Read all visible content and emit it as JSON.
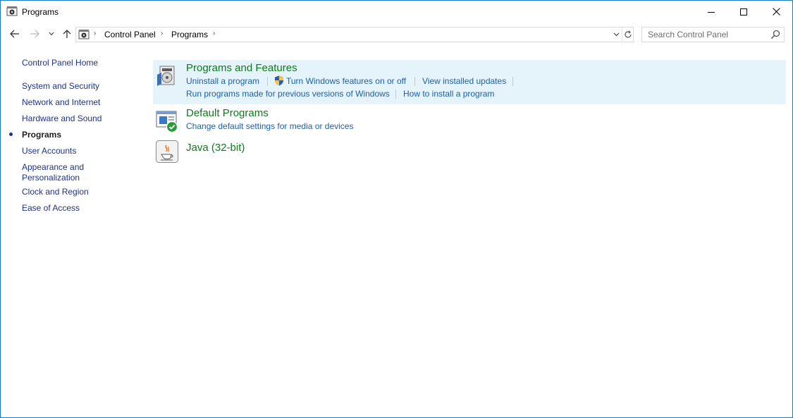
{
  "window": {
    "title": "Programs",
    "controls": {
      "minimize": "minimize",
      "maximize": "maximize",
      "close": "close"
    }
  },
  "address": {
    "breadcrumbs": [
      "Control Panel",
      "Programs"
    ],
    "search_placeholder": "Search Control Panel"
  },
  "sidebar": {
    "items": [
      {
        "label": "Control Panel Home"
      },
      {
        "label": "System and Security"
      },
      {
        "label": "Network and Internet"
      },
      {
        "label": "Hardware and Sound"
      },
      {
        "label": "Programs",
        "current": true
      },
      {
        "label": "User Accounts"
      },
      {
        "label": "Appearance and"
      },
      {
        "label": "Personalization"
      },
      {
        "label": "Clock and Region"
      },
      {
        "label": "Ease of Access"
      }
    ]
  },
  "categories": {
    "programs_features": {
      "title": "Programs and Features",
      "links": [
        "Uninstall a program",
        "Turn Windows features on or off",
        "View installed updates",
        "Run programs made for previous versions of Windows",
        "How to install a program"
      ]
    },
    "default_programs": {
      "title": "Default Programs",
      "links": [
        "Change default settings for media or devices"
      ]
    },
    "java": {
      "title": "Java (32-bit)"
    }
  },
  "colors": {
    "window_border": "#1979ca",
    "link": "#1e5fa8",
    "nav_link": "#1e3287",
    "category_title": "#0f7a1c",
    "highlight_bg": "#e5f3fb"
  },
  "icons": {
    "app": "control-panel-icon",
    "back": "arrow-left-icon",
    "forward": "arrow-right-icon",
    "recent": "chevron-down-icon",
    "up": "arrow-up-icon",
    "refresh": "refresh-icon",
    "search": "search-icon",
    "programs": "programs-features-icon",
    "defaults": "default-programs-icon",
    "java": "java-icon",
    "uac": "shield-icon"
  }
}
